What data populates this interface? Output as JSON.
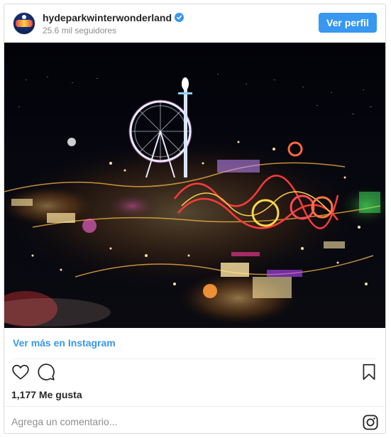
{
  "header": {
    "username": "hydeparkwinterwonderland",
    "followers": "25.6 mil seguidores",
    "follow_button": "Ver perfil"
  },
  "post": {
    "view_more": "Ver más en Instagram",
    "likes": "1,177 Me gusta",
    "comment_placeholder": "Agrega un comentario..."
  },
  "icons": {
    "like": "heart-icon",
    "comment": "comment-icon",
    "save": "bookmark-icon",
    "brand": "instagram-icon",
    "verified": "verified-badge-icon"
  },
  "colors": {
    "accent": "#3897f0",
    "text": "#262626",
    "muted": "#8e8e8e",
    "border": "#dbdbdb"
  }
}
